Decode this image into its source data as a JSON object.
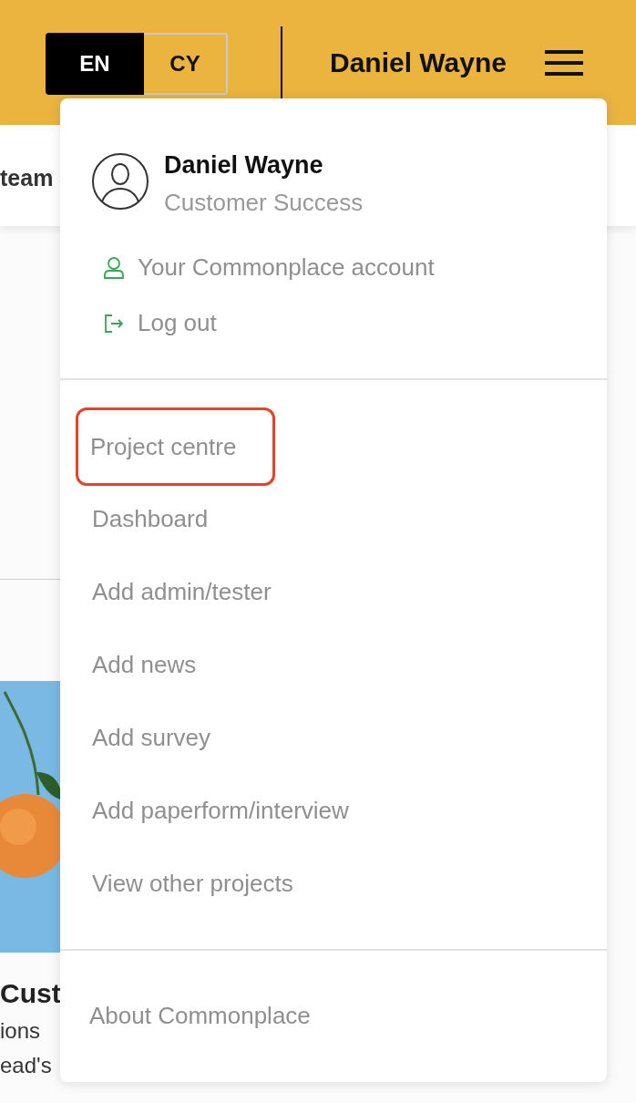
{
  "header": {
    "languages": [
      {
        "label": "EN",
        "selected": true
      },
      {
        "label": "CY",
        "selected": false
      }
    ],
    "user_name": "Daniel Wayne"
  },
  "background": {
    "tab_label": "team",
    "card": {
      "kind": "picture",
      "title": "Cust",
      "lines": [
        "ions",
        "ead's"
      ]
    }
  },
  "menu": {
    "profile": {
      "name": "Daniel Wayne",
      "role": "Customer Success"
    },
    "account_links": [
      {
        "kind": "account",
        "label": "Your Commonplace account"
      },
      {
        "kind": "logout",
        "label": "Log out"
      }
    ],
    "items": [
      {
        "label": "Project centre",
        "highlighted": true
      },
      {
        "label": "Dashboard",
        "highlighted": false
      },
      {
        "label": "Add admin/tester",
        "highlighted": false
      },
      {
        "label": "Add news",
        "highlighted": false
      },
      {
        "label": "Add survey",
        "highlighted": false
      },
      {
        "label": "Add paperform/interview",
        "highlighted": false
      },
      {
        "label": "View other projects",
        "highlighted": false
      }
    ],
    "footer_items": [
      "About Commonplace"
    ]
  }
}
